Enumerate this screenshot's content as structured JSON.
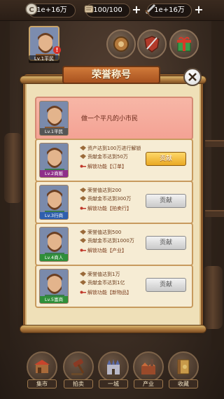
{
  "topbar": {
    "coins": "1e+16万",
    "stamina": "100/100",
    "ticket": "1e+16万"
  },
  "player": {
    "level_label": "Lv.1平民",
    "badge": "!"
  },
  "dialog": {
    "title": "荣誉称号",
    "current_title": "做一个平凡的小市民",
    "current_level": "Lv.1平民",
    "rows": [
      {
        "level": "Lv.2商贩",
        "req1": "资产达到100万进行解锁",
        "req2": "贡献金币达到50万",
        "unlock": "解锁功能【订单】",
        "button": "贡献",
        "state": "active",
        "level_color": "#8f2f8a"
      },
      {
        "level": "Lv.3行商",
        "req1": "荣誉值达到200",
        "req2": "贡献金币达到300万",
        "unlock": "解锁功能【拍卖行】",
        "button": "贡献",
        "state": "disabled",
        "level_color": "#2e5fae"
      },
      {
        "level": "Lv.4商人",
        "req1": "荣誉值达到500",
        "req2": "贡献金币达到1000万",
        "unlock": "解锁功能【产业】",
        "button": "贡献",
        "state": "disabled",
        "level_color": "#2f8f3a"
      },
      {
        "level": "Lv.5富商",
        "req1": "荣誉值达到1万",
        "req2": "贡献金币达到1亿",
        "unlock": "解锁功能【新物品】",
        "button": "贡献",
        "state": "disabled",
        "level_color": "#2f8f3a"
      }
    ]
  },
  "nav": [
    "集市",
    "拍卖",
    "一城",
    "产业",
    "收藏"
  ],
  "colors": {
    "accent_gold": "#e9a823",
    "frame_brown": "#8b5a2b",
    "parchment": "#efe0b8",
    "highlight_row": "#f4a294"
  }
}
